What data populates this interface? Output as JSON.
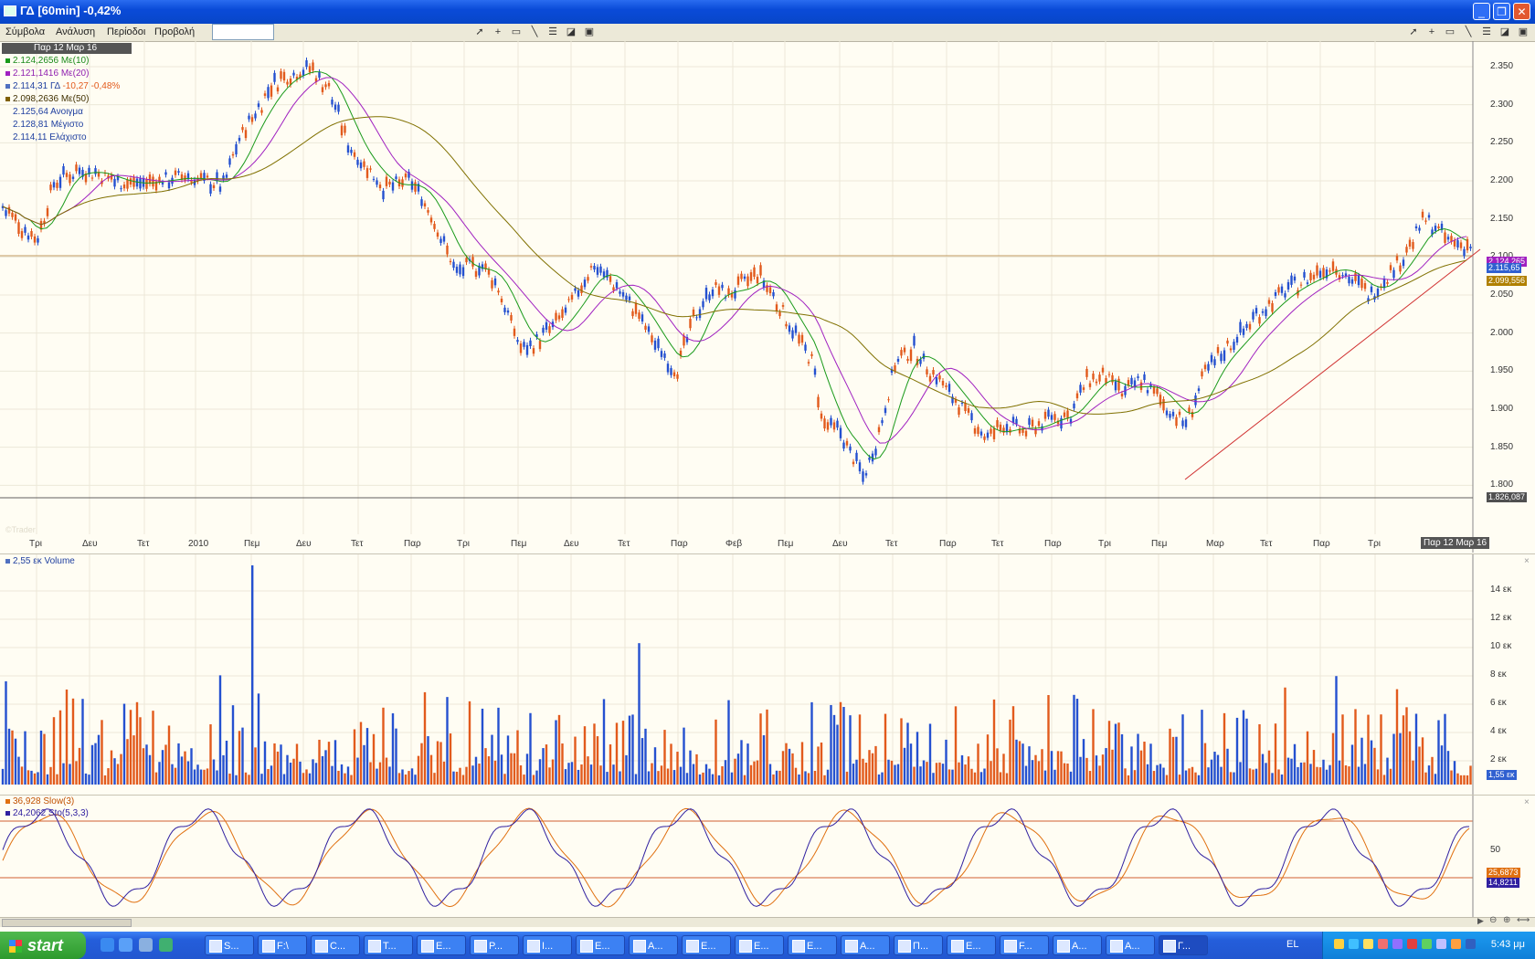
{
  "window": {
    "title": "ΓΔ [60min] -0,42%"
  },
  "menu": [
    "Σύμβολα",
    "Ανάλυση",
    "Περίοδοι",
    "Προβολή"
  ],
  "symbol_input": {
    "value": ""
  },
  "price": {
    "date_label": "Παρ 12 Μαρ 16",
    "legend": [
      {
        "text": "2.124,2656 Με(10)",
        "color": "#1a9a1a"
      },
      {
        "text": "2.121,1416 Με(20)",
        "color": "#a020c0"
      },
      {
        "text": "2.114,31 ΓΔ",
        "extra": "-10,27 -0,48%",
        "color": "#2040a0"
      },
      {
        "text": "2.098,2636 Με(50)",
        "color": "#605000"
      },
      {
        "text": "2.125,64 Ανοιγμα",
        "color": "#2040a0"
      },
      {
        "text": "2.128,81 Μέγιστο",
        "color": "#2040a0"
      },
      {
        "text": "2.114,11 Ελάχιστο",
        "color": "#2040a0"
      }
    ],
    "y_ticks": [
      "2.350",
      "2.300",
      "2.250",
      "2.200",
      "2.150",
      "2.100",
      "2.050",
      "2.000",
      "1.950",
      "1.900",
      "1.850",
      "1.800"
    ],
    "x_ticks": [
      "Τρι",
      "Δευ",
      "Τετ",
      "2010",
      "Πεμ",
      "Δευ",
      "Τετ",
      "Παρ",
      "Τρι",
      "Πεμ",
      "Δευ",
      "Τετ",
      "Παρ",
      "Φεβ",
      "Πεμ",
      "Δευ",
      "Τετ",
      "Παρ",
      "Τετ",
      "Παρ",
      "Τρι",
      "Πεμ",
      "Μαρ",
      "Τετ",
      "Παρ",
      "Τρι"
    ],
    "x_current": "Παρ 12 Μαρ 16",
    "tags": {
      "ma10": "2.124,265",
      "last": "2.115,65",
      "ma50": "2.099,556",
      "support": "1.826,087"
    },
    "watermark": "©Trader"
  },
  "volume": {
    "legend": "2,55 εκ Volume",
    "y_ticks": [
      "14 εκ",
      "12 εκ",
      "10 εκ",
      "8 εκ",
      "6 εκ",
      "4 εκ",
      "2 εκ"
    ],
    "tag": "1,55 εκ"
  },
  "stoch": {
    "legend": [
      {
        "text": "36,928 Slow(3)",
        "color": "#e07010"
      },
      {
        "text": "24,2062 Sto(5,3,3)",
        "color": "#3020a0"
      }
    ],
    "y_ticks": [
      "50"
    ],
    "tags": {
      "slow": "25,6873",
      "sto": "14,8211"
    }
  },
  "colors": {
    "up": "#2450d0",
    "down": "#e25a1c",
    "ma10": "#1a9a1a",
    "ma20": "#a020c0",
    "ma50": "#807000",
    "bg": "#fffdf3"
  },
  "taskbar": {
    "start_label": "start",
    "buttons": [
      "S...",
      "F:\\",
      "C...",
      "T...",
      "E...",
      "P...",
      "I...",
      "E...",
      "A...",
      "E...",
      "E...",
      "E...",
      "A...",
      "Π...",
      "E...",
      "F...",
      "A...",
      "A...",
      "Γ..."
    ],
    "language": "EL",
    "clock": "5:43 μμ"
  }
}
